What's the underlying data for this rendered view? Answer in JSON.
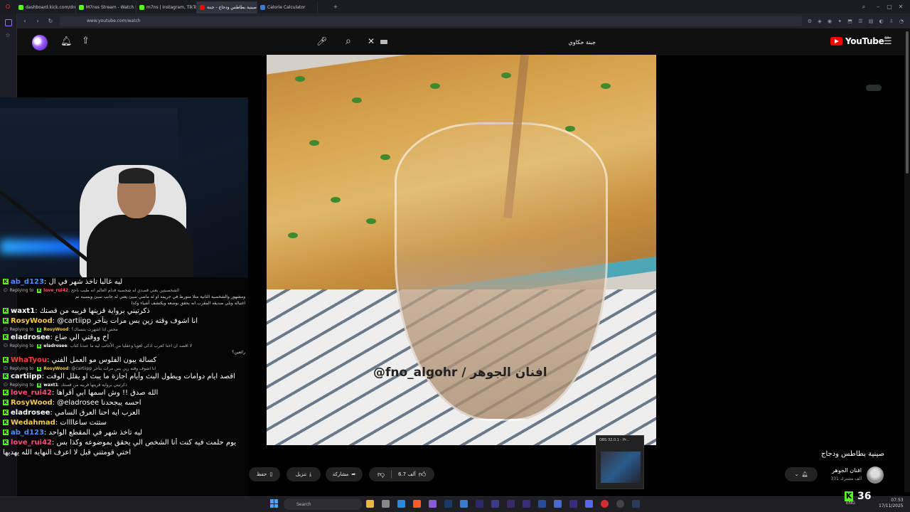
{
  "browser": {
    "tabs": [
      {
        "label": "dashboard.kick.com/dropp",
        "color": "#53fc18"
      },
      {
        "label": "M7nss Stream - Watch Li",
        "color": "#53fc18"
      },
      {
        "label": "m7ns | Instagram, TikTok |",
        "color": "#53fc18"
      },
      {
        "label": "صينية بطاطس ودجاج - جبنة",
        "color": "#ff0000",
        "active": true
      },
      {
        "label": "Calorie Calculator",
        "color": "#3a7bd5"
      }
    ],
    "url": "www.youtube.com/watch"
  },
  "youtube": {
    "logo_text": "YouTube",
    "country": "SA",
    "search_query": "جبنة حكاوي",
    "video_title": "صينية بطاطس ودجاج",
    "watermark": "@fno_algohr / افنان الجوهر",
    "channel_name": "افنان الجوهر",
    "channel_subs": "331 ألف مشترك",
    "like_count": "6.7 ألف",
    "share_label": "مشاركة",
    "download_label": "تنزيل",
    "save_label": "حفظ"
  },
  "chat": {
    "messages": [
      {
        "type": "msg",
        "user": "ab_d123",
        "color": "#4b8cff",
        "text": "ليه غالبا تاخذ شهر في ال"
      },
      {
        "type": "reply",
        "to": "love_rui42",
        "to_color": "#ff4d7a",
        "text": "الشخصيتين يعني قصدي له شخصية قدام العالم انه طيب ناجح"
      },
      {
        "type": "ctx",
        "text": "ومشهور والشخصية الثانية متلا متورط في جريمه او له ماضي سيئ يعني له جانب سيئ وبسببه تم"
      },
      {
        "type": "ctx",
        "text": "اغتياله ويلي صديقه المقرب انه يحقق بوضعه ويكتشف أشياء وكذا"
      },
      {
        "type": "msg",
        "user": "waxt1",
        "color": "#ffffff",
        "text": "ذكرتيني برواية قريتها قريبه من قصتك"
      },
      {
        "type": "msg",
        "user": "RosyWood",
        "color": "#f2c94c",
        "text": "@cartiipp انا اشوف وقته زين بس مرات يتأخر"
      },
      {
        "type": "reply",
        "to": "RosyWood",
        "to_color": "#f2c94c",
        "text": "محس اذا اشهرت بتنساك؟"
      },
      {
        "type": "msg",
        "user": "eladrosee",
        "color": "#ffffff",
        "text": "اخ ووقتي الي ضاع"
      },
      {
        "type": "reply",
        "to": "eladrosee",
        "to_color": "#ffffff",
        "text": "لا اقصد ان احنا كعرب اذكى لغويا وعقليا من الأجانب ليه ما عندنا كتاب"
      },
      {
        "type": "ctx",
        "text": "رائعين؟"
      },
      {
        "type": "msg",
        "user": "WhaTyou",
        "color": "#ff3b3b",
        "text": "كسالة يبون الفلوس مو العمل الفني"
      },
      {
        "type": "reply",
        "to": "RosyWood",
        "to_color": "#f2c94c",
        "text": "@cartiipp انا اشوف وقته زين بس مرات يتأخر"
      },
      {
        "type": "msg",
        "user": "cartiipp",
        "color": "#ffffff",
        "text": "اقصد ايام دوامات ويطول البث وأيام اجازة ما يبث او يقلل الوقت"
      },
      {
        "type": "reply",
        "to": "waxt1",
        "to_color": "#ffffff",
        "text": "ذكرتيني برواية قريتها قريبه من قصتك"
      },
      {
        "type": "msg",
        "user": "love_rui42",
        "color": "#ff4d7a",
        "text": "الله صدق !! وش اسمها ابي أقراها"
      },
      {
        "type": "msg",
        "user": "RosyWood",
        "color": "#f2c94c",
        "text": "@eladrosee احسه يبجحدنا"
      },
      {
        "type": "msg",
        "user": "eladrosee",
        "color": "#ffffff",
        "text": "العرب ايه احنا العرق السامي"
      },
      {
        "type": "msg",
        "user": "Wedahmad",
        "color": "#f2c94c",
        "text": "ستتت ساعاااات"
      },
      {
        "type": "msg",
        "user": "ab_d123",
        "color": "#4b8cff",
        "text": "ليه تاخذ شهر في المقطع الواحد"
      },
      {
        "type": "msg",
        "user": "love_rui42",
        "color": "#ff4d7a",
        "text": "يوم حلمت فيه كنت أنا الشخص الي يحقق بموضوعه وكذا بس"
      },
      {
        "type": "ctx2",
        "text": "اختي قومتني قبل لا اعرف النهايه الله يهديها"
      }
    ],
    "replying_to": "Replying to"
  },
  "stream": {
    "viewer_count": "36"
  },
  "obs": {
    "label": "OBS 32.0.1 - Pr..."
  },
  "taskbar": {
    "search_placeholder": "Search",
    "lang": "ENG",
    "time": "07:53",
    "date": "17/11/2025"
  }
}
